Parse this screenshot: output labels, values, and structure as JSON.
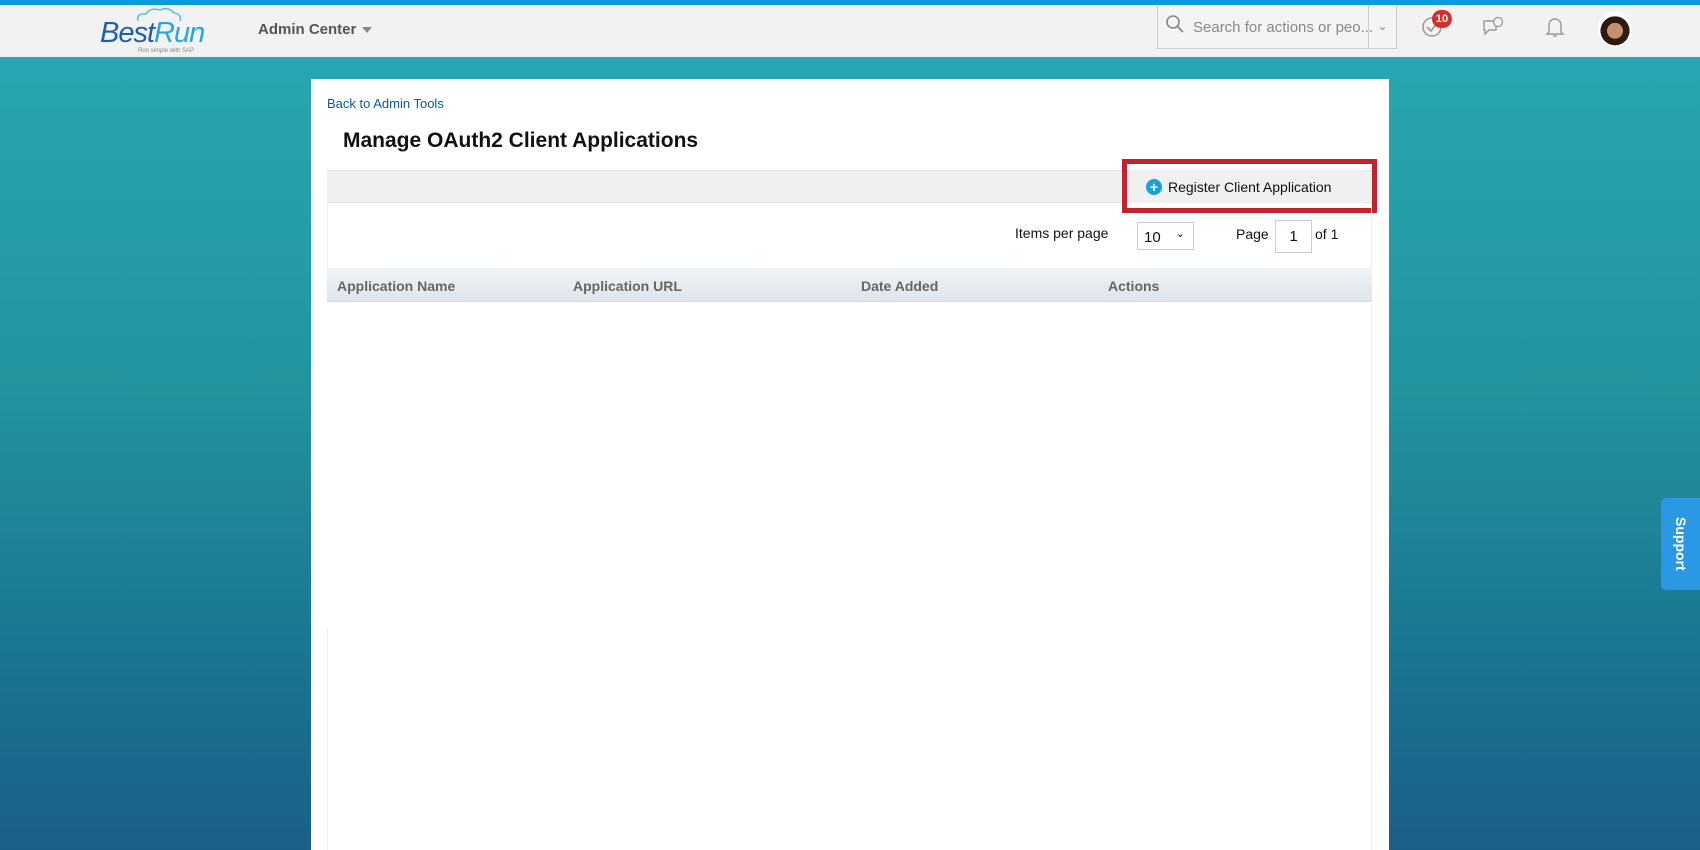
{
  "header": {
    "logo_text_1": "Best",
    "logo_text_2": "Run",
    "logo_tagline": "Run simple with SAP",
    "module": "Admin Center",
    "search_placeholder": "Search for actions or peo...",
    "notification_count": "10",
    "icons": [
      "search-icon",
      "chevron-down-icon",
      "todo-check-icon",
      "feedback-chat-icon",
      "bell-icon",
      "avatar"
    ]
  },
  "page": {
    "back_link": "Back to Admin Tools",
    "title": "Manage OAuth2 Client Applications",
    "register_button": "Register Client Application",
    "items_per_page_label": "Items per page",
    "items_per_page_value": "10",
    "page_label": "Page",
    "page_value": "1",
    "of_label": "of 1",
    "columns": [
      "Application Name",
      "Application URL",
      "Date Added",
      "Actions"
    ],
    "rows": []
  },
  "support_label": "Support",
  "colors": {
    "highlight": "#c4222f",
    "accent": "#1aa1db",
    "topbar": "#0a9ade"
  }
}
